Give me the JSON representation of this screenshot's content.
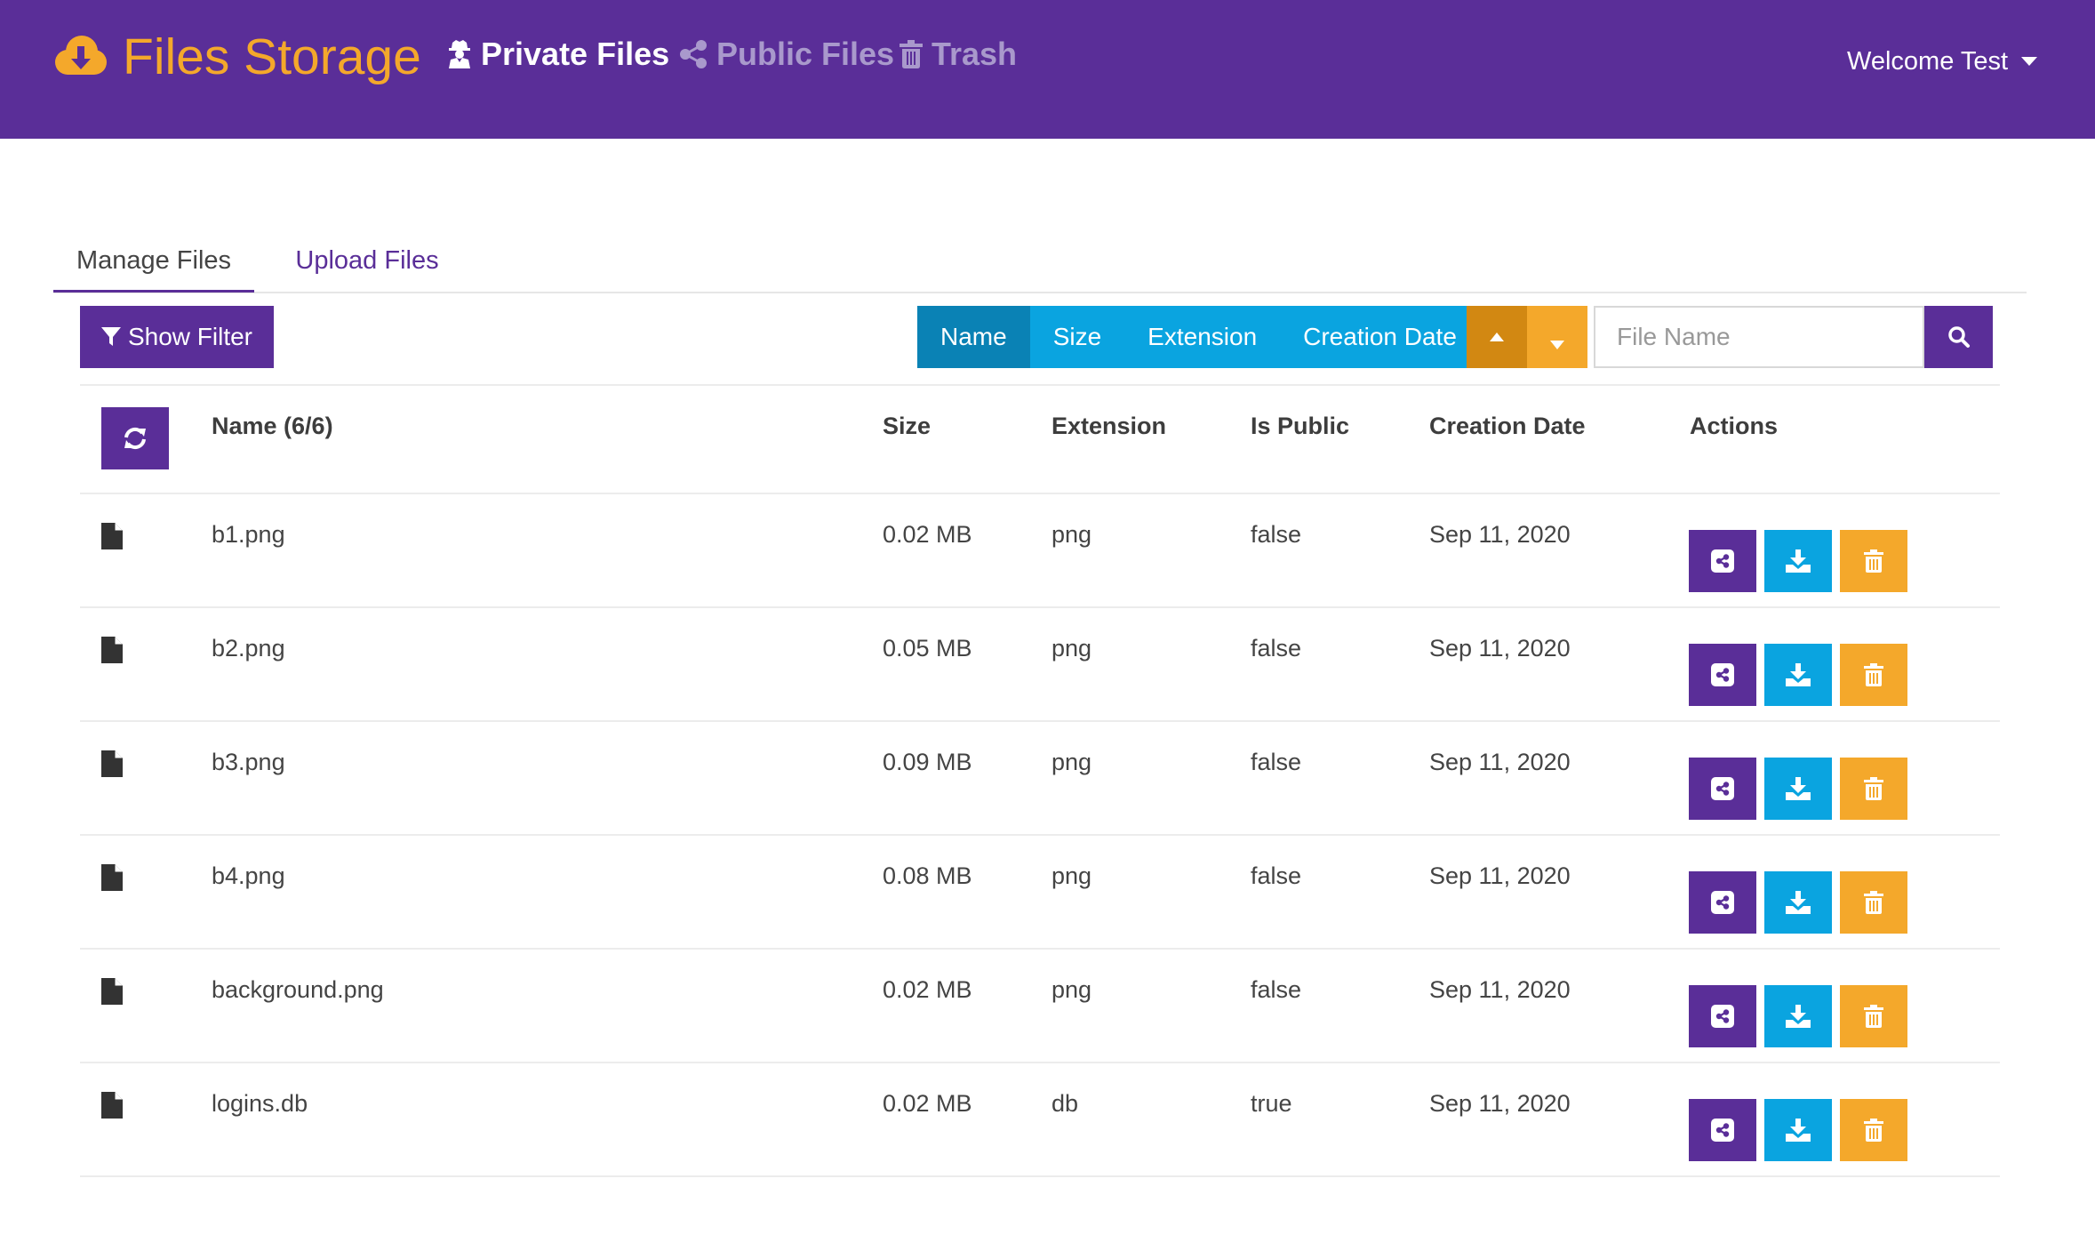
{
  "colors": {
    "primary": "#5a2e98",
    "accent": "#f4a82b",
    "accent_dark": "#d28812",
    "info": "#0aa4e0",
    "info_active": "#0a82b5"
  },
  "navbar": {
    "brand": "Files Storage",
    "brand_icon": "cloud-download-icon",
    "links": [
      {
        "label": "Private Files",
        "icon": "user-secret-icon",
        "active": true
      },
      {
        "label": "Public Files",
        "icon": "share-icon",
        "active": false
      },
      {
        "label": "Trash",
        "icon": "trash-icon",
        "active": false
      }
    ],
    "user_menu": "Welcome Test"
  },
  "tabs": [
    {
      "label": "Manage Files",
      "active": true
    },
    {
      "label": "Upload Files",
      "active": false
    }
  ],
  "toolbar": {
    "show_filter": "Show Filter",
    "sort_options": [
      "Name",
      "Size",
      "Extension",
      "Creation Date"
    ],
    "sort_active": "Name",
    "search_placeholder": "File Name"
  },
  "table": {
    "headers": {
      "name": "Name (6/6)",
      "size": "Size",
      "extension": "Extension",
      "is_public": "Is Public",
      "creation_date": "Creation Date",
      "actions": "Actions"
    },
    "rows": [
      {
        "name": "b1.png",
        "size": "0.02 MB",
        "extension": "png",
        "is_public": "false",
        "creation_date": "Sep 11, 2020"
      },
      {
        "name": "b2.png",
        "size": "0.05 MB",
        "extension": "png",
        "is_public": "false",
        "creation_date": "Sep 11, 2020"
      },
      {
        "name": "b3.png",
        "size": "0.09 MB",
        "extension": "png",
        "is_public": "false",
        "creation_date": "Sep 11, 2020"
      },
      {
        "name": "b4.png",
        "size": "0.08 MB",
        "extension": "png",
        "is_public": "false",
        "creation_date": "Sep 11, 2020"
      },
      {
        "name": "background.png",
        "size": "0.02 MB",
        "extension": "png",
        "is_public": "false",
        "creation_date": "Sep 11, 2020"
      },
      {
        "name": "logins.db",
        "size": "0.02 MB",
        "extension": "db",
        "is_public": "true",
        "creation_date": "Sep 11, 2020"
      }
    ]
  }
}
